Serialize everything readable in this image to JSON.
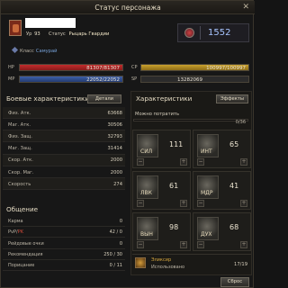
{
  "window": {
    "title": "Статус персонажа",
    "close": "✕"
  },
  "header": {
    "level_label": "Ур",
    "level": "93",
    "status_label": "Статус",
    "status_value": "Рыцарь Гвардии",
    "power": "1552",
    "class_label": "Класс",
    "class_value": "Самурай"
  },
  "bars": {
    "hp": {
      "label": "HP",
      "text": "81307/81307",
      "fill": 1.0
    },
    "mp": {
      "label": "MP",
      "text": "22052/22052",
      "fill": 1.0
    },
    "cp": {
      "label": "CP",
      "text": "100997/100997",
      "fill": 1.0
    },
    "sp": {
      "label": "SP",
      "text": "13282069",
      "fill": 0.0
    }
  },
  "combat": {
    "title": "Боевые характеристики",
    "details_button": "Детали",
    "rows": [
      {
        "k": "Физ. Атк.",
        "v": "63668"
      },
      {
        "k": "Маг. Атк.",
        "v": "30506"
      },
      {
        "k": "Физ. Защ.",
        "v": "32793"
      },
      {
        "k": "Маг. Защ.",
        "v": "31414"
      },
      {
        "k": "Скор. Атк.",
        "v": "2000"
      },
      {
        "k": "Скор. Маг.",
        "v": "2000"
      },
      {
        "k": "Скорость",
        "v": "274"
      }
    ]
  },
  "social": {
    "title": "Общение",
    "rows": [
      {
        "k": "Карма",
        "v": "0"
      },
      {
        "k_pre": "PvP/",
        "k_red": "PK",
        "v": "42 / 0"
      },
      {
        "k": "Рейдовые очки",
        "v": "0"
      },
      {
        "k": "Рекомендация",
        "v": "250 / 30"
      },
      {
        "k": "Порицание",
        "v": "0 / 11"
      }
    ]
  },
  "attributes": {
    "title": "Характеристики",
    "effects_button": "Эффекты",
    "points_label": "Можно потратить",
    "points_value": "0/36",
    "stats": [
      {
        "label": "СИЛ",
        "value": "111"
      },
      {
        "label": "ИНТ",
        "value": "65"
      },
      {
        "label": "ЛВК",
        "value": "61"
      },
      {
        "label": "МДР",
        "value": "41"
      },
      {
        "label": "ВЫН",
        "value": "98"
      },
      {
        "label": "ДУХ",
        "value": "68"
      }
    ],
    "minus": "−",
    "plus": "+"
  },
  "elixir": {
    "name": "Эликсир",
    "used_label": "Использовано",
    "count": "17/19"
  },
  "reset_button": "Сброс"
}
